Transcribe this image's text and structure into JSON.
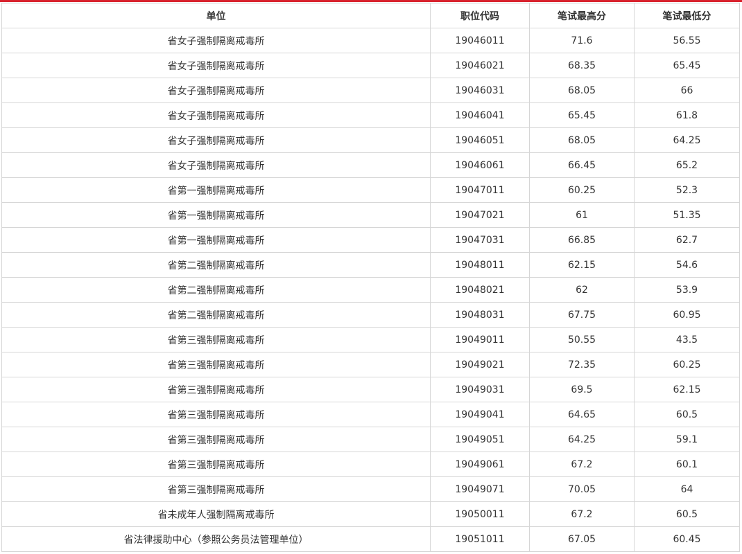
{
  "table": {
    "headers": [
      "单位",
      "职位代码",
      "笔试最高分",
      "笔试最低分"
    ],
    "rows": [
      [
        "省女子强制隔离戒毒所",
        "19046011",
        "71.6",
        "56.55"
      ],
      [
        "省女子强制隔离戒毒所",
        "19046021",
        "68.35",
        "65.45"
      ],
      [
        "省女子强制隔离戒毒所",
        "19046031",
        "68.05",
        "66"
      ],
      [
        "省女子强制隔离戒毒所",
        "19046041",
        "65.45",
        "61.8"
      ],
      [
        "省女子强制隔离戒毒所",
        "19046051",
        "68.05",
        "64.25"
      ],
      [
        "省女子强制隔离戒毒所",
        "19046061",
        "66.45",
        "65.2"
      ],
      [
        "省第一强制隔离戒毒所",
        "19047011",
        "60.25",
        "52.3"
      ],
      [
        "省第一强制隔离戒毒所",
        "19047021",
        "61",
        "51.35"
      ],
      [
        "省第一强制隔离戒毒所",
        "19047031",
        "66.85",
        "62.7"
      ],
      [
        "省第二强制隔离戒毒所",
        "19048011",
        "62.15",
        "54.6"
      ],
      [
        "省第二强制隔离戒毒所",
        "19048021",
        "62",
        "53.9"
      ],
      [
        "省第二强制隔离戒毒所",
        "19048031",
        "67.75",
        "60.95"
      ],
      [
        "省第三强制隔离戒毒所",
        "19049011",
        "50.55",
        "43.5"
      ],
      [
        "省第三强制隔离戒毒所",
        "19049021",
        "72.35",
        "60.25"
      ],
      [
        "省第三强制隔离戒毒所",
        "19049031",
        "69.5",
        "62.15"
      ],
      [
        "省第三强制隔离戒毒所",
        "19049041",
        "64.65",
        "60.5"
      ],
      [
        "省第三强制隔离戒毒所",
        "19049051",
        "64.25",
        "59.1"
      ],
      [
        "省第三强制隔离戒毒所",
        "19049061",
        "67.2",
        "60.1"
      ],
      [
        "省第三强制隔离戒毒所",
        "19049071",
        "70.05",
        "64"
      ],
      [
        "省未成年人强制隔离戒毒所",
        "19050011",
        "67.2",
        "60.5"
      ],
      [
        "省法律援助中心（参照公务员法管理单位）",
        "19051011",
        "67.05",
        "60.45"
      ]
    ]
  },
  "colors": {
    "accent_line": "#d9232e",
    "border": "#d6d6d6",
    "text": "#333333"
  }
}
